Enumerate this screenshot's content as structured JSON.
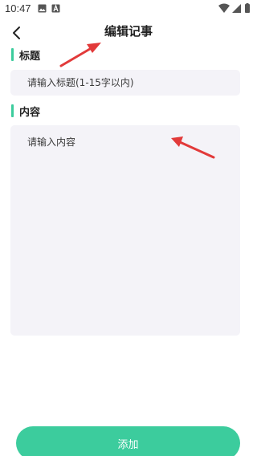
{
  "status_bar": {
    "time": "10:47",
    "left_icons": [
      "image-icon",
      "a-badge-icon"
    ],
    "right_icons": [
      "wifi-icon",
      "signal-icon",
      "battery-icon"
    ]
  },
  "nav": {
    "title": "编辑记事",
    "back_icon": "chevron-left-icon"
  },
  "form": {
    "title_label": "标题",
    "title_placeholder": "请输入标题(1-15字以内)",
    "title_value": "",
    "content_label": "内容",
    "content_placeholder": "请输入内容",
    "content_value": ""
  },
  "submit_label": "添加",
  "colors": {
    "accent": "#3ccc9d",
    "field_background": "#f4f3f8",
    "annotation_arrow": "#e23a3a"
  }
}
